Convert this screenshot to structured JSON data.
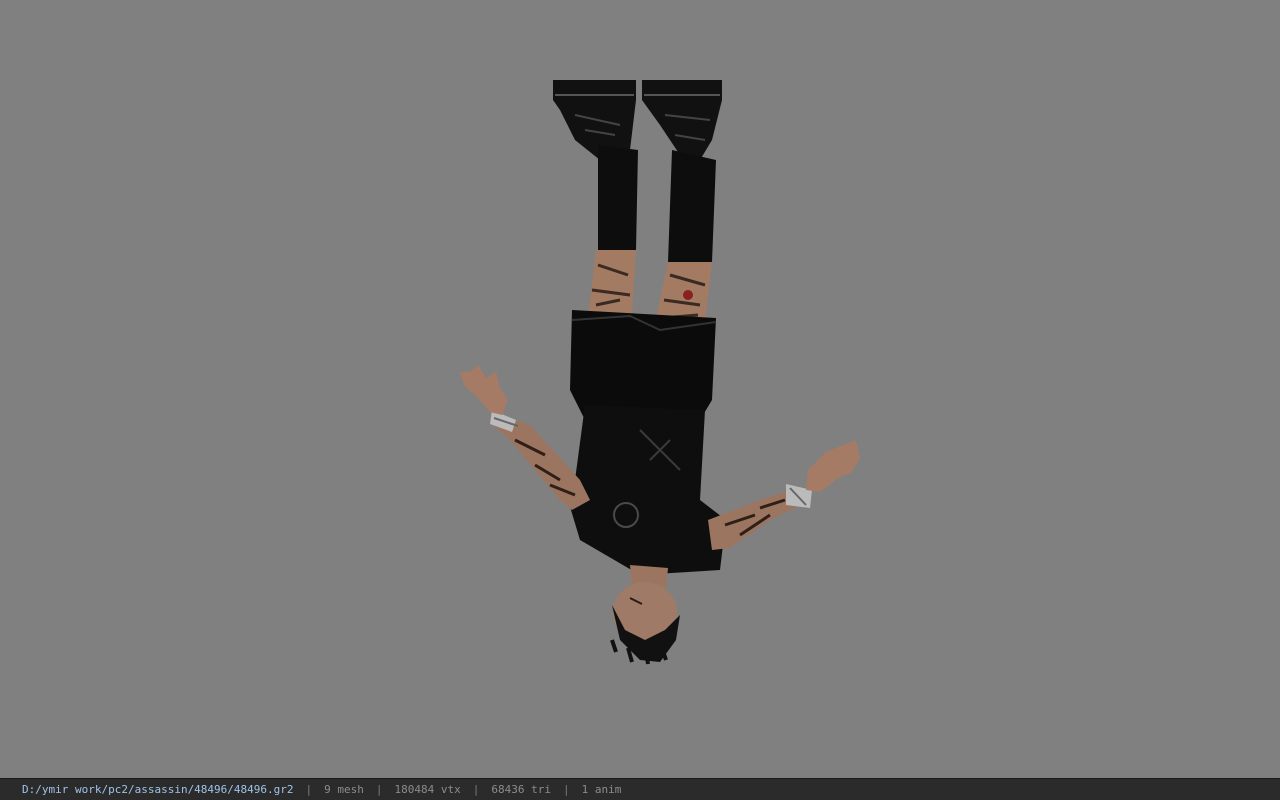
{
  "viewport": {
    "background_color": "#808080",
    "model_description_icon": "upside-down-character-model"
  },
  "statusbar": {
    "file_path": "D:/ymir work/pc2/assassin/48496/48496.gr2",
    "separator": "|",
    "mesh_count": "9 mesh",
    "vertex_count": "180484 vtx",
    "triangle_count": "68436 tri",
    "anim_count": "1 anim",
    "path_color": "#9fc3e8",
    "text_color": "#8c8c8c",
    "background_color": "#2b2b2b"
  }
}
